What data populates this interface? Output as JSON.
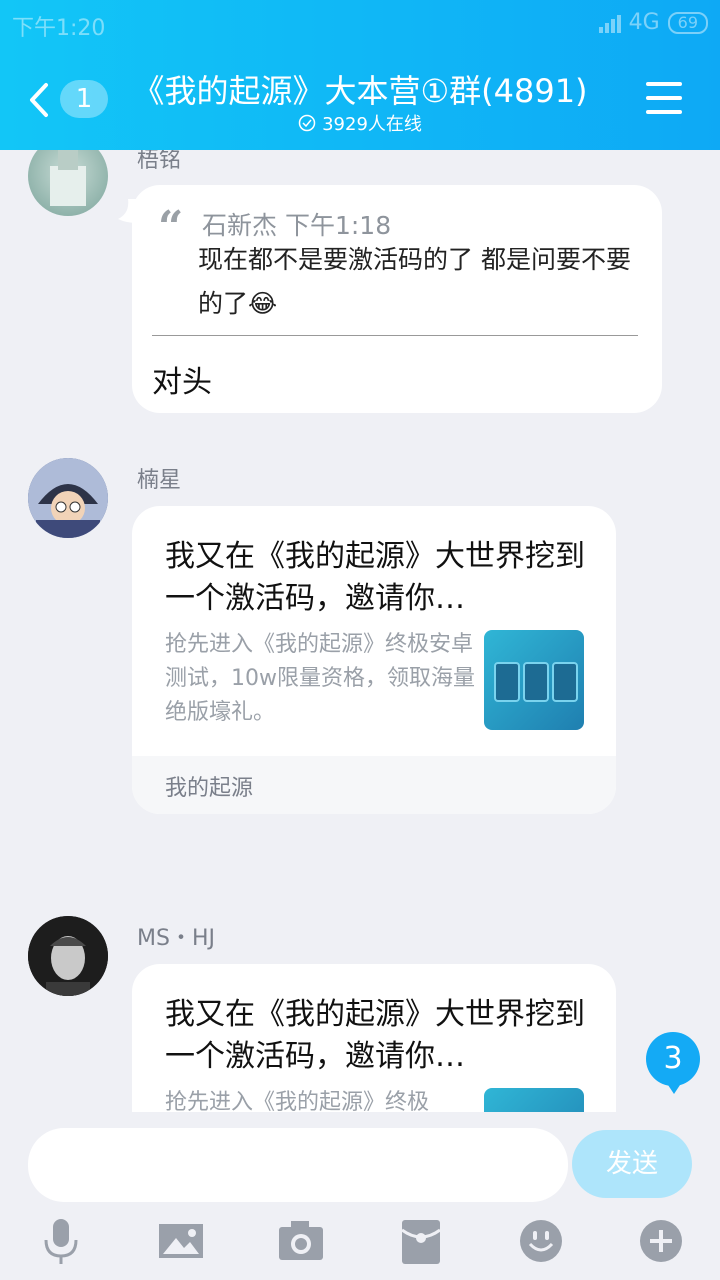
{
  "status_bar": {
    "time": "下午1:20",
    "network": "4G",
    "battery": "69"
  },
  "header": {
    "back_count": "1",
    "title": "《我的起源》大本营①群(4891)",
    "online": "3929人在线"
  },
  "messages": [
    {
      "sender": "梧铭",
      "quote_author": "石新杰",
      "quote_time": "下午1:18",
      "quote_text": "现在都不是要激活码的了  都是问要不要的了😂",
      "reply": "对头"
    },
    {
      "sender": "楠星",
      "card_title": "我又在《我的起源》大世界挖到一个激活码，邀请你…",
      "card_desc": "抢先进入《我的起源》终极安卓测试，10w限量资格，领取海量绝版壕礼。",
      "card_source": "我的起源"
    },
    {
      "sender": "MS・HJ",
      "card_title": "我又在《我的起源》大世界挖到一个激活码，邀请你…",
      "card_desc": "抢先进入《我的起源》终极"
    }
  ],
  "unread_badge": "3",
  "composer": {
    "send_label": "发送",
    "placeholder": ""
  },
  "toolbar_icons": [
    "microphone-icon",
    "image-icon",
    "camera-icon",
    "red-packet-icon",
    "emoji-icon",
    "plus-icon"
  ],
  "colors": {
    "header": "#12c6f7",
    "accent": "#14aaf5",
    "background": "#eff0f5"
  }
}
